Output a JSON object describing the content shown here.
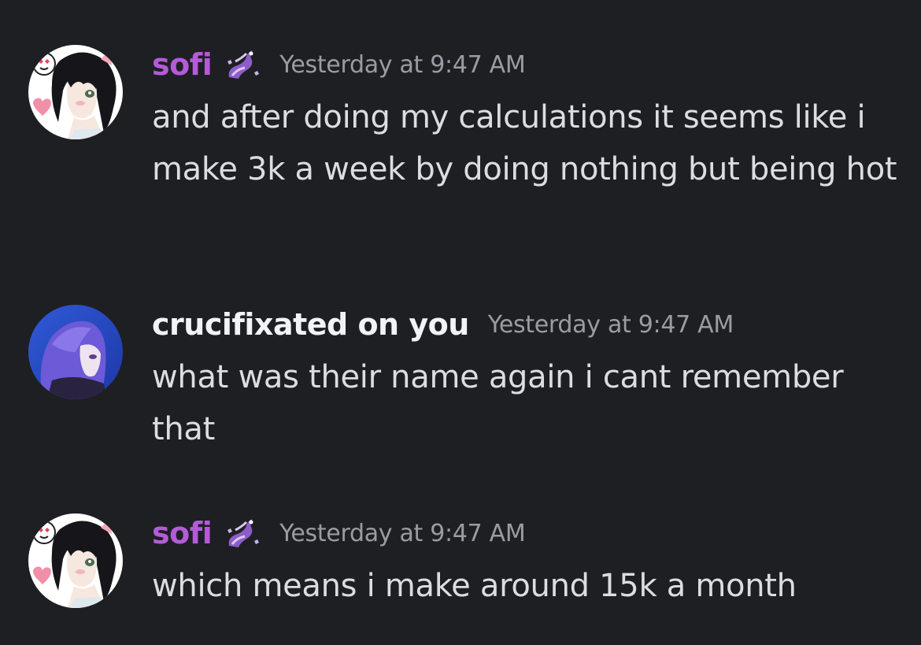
{
  "messages": [
    {
      "username": "sofi",
      "username_color": "#b35bd8",
      "has_role_icon": true,
      "role_icon": "purple-dragon-icon",
      "timestamp": "Yesterday at 9:47 AM",
      "text": "and after doing my calculations it seems like i make 3k a week by doing nothing but being hot"
    },
    {
      "username": "crucifixated on you",
      "username_color": "#f2f3f5",
      "has_role_icon": false,
      "timestamp": "Yesterday at 9:47 AM",
      "text": "what was their name again i cant remember that"
    },
    {
      "username": "sofi",
      "username_color": "#b35bd8",
      "has_role_icon": true,
      "role_icon": "purple-dragon-icon",
      "timestamp": "Yesterday at 9:47 AM",
      "text": "which means i make around 15k a month"
    }
  ]
}
